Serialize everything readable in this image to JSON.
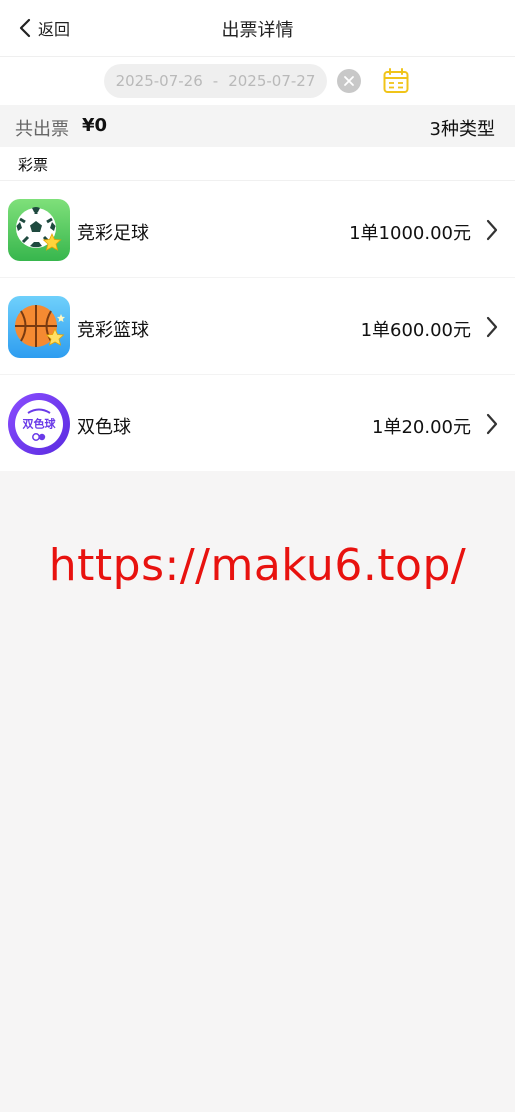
{
  "header": {
    "back_label": "返回",
    "title": "出票详情"
  },
  "date_filter": {
    "start": "2025-07-26",
    "separator": "-",
    "end": "2025-07-27"
  },
  "summary": {
    "label": "共出票",
    "value": "¥0",
    "types": "3种类型"
  },
  "section": {
    "title": "彩票"
  },
  "lotteries": [
    {
      "name": "竞彩足球",
      "amount": "1单1000.00元",
      "icon": "soccer-ball-icon"
    },
    {
      "name": "竞彩篮球",
      "amount": "1单600.00元",
      "icon": "basketball-icon"
    },
    {
      "name": "双色球",
      "amount": "1单20.00元",
      "icon": "double-color-ball-icon",
      "icon_text": "双色球"
    }
  ],
  "watermark": "https://maku6.top/",
  "colors": {
    "accent_calendar": "#f0c419",
    "watermark": "#e8120f"
  }
}
